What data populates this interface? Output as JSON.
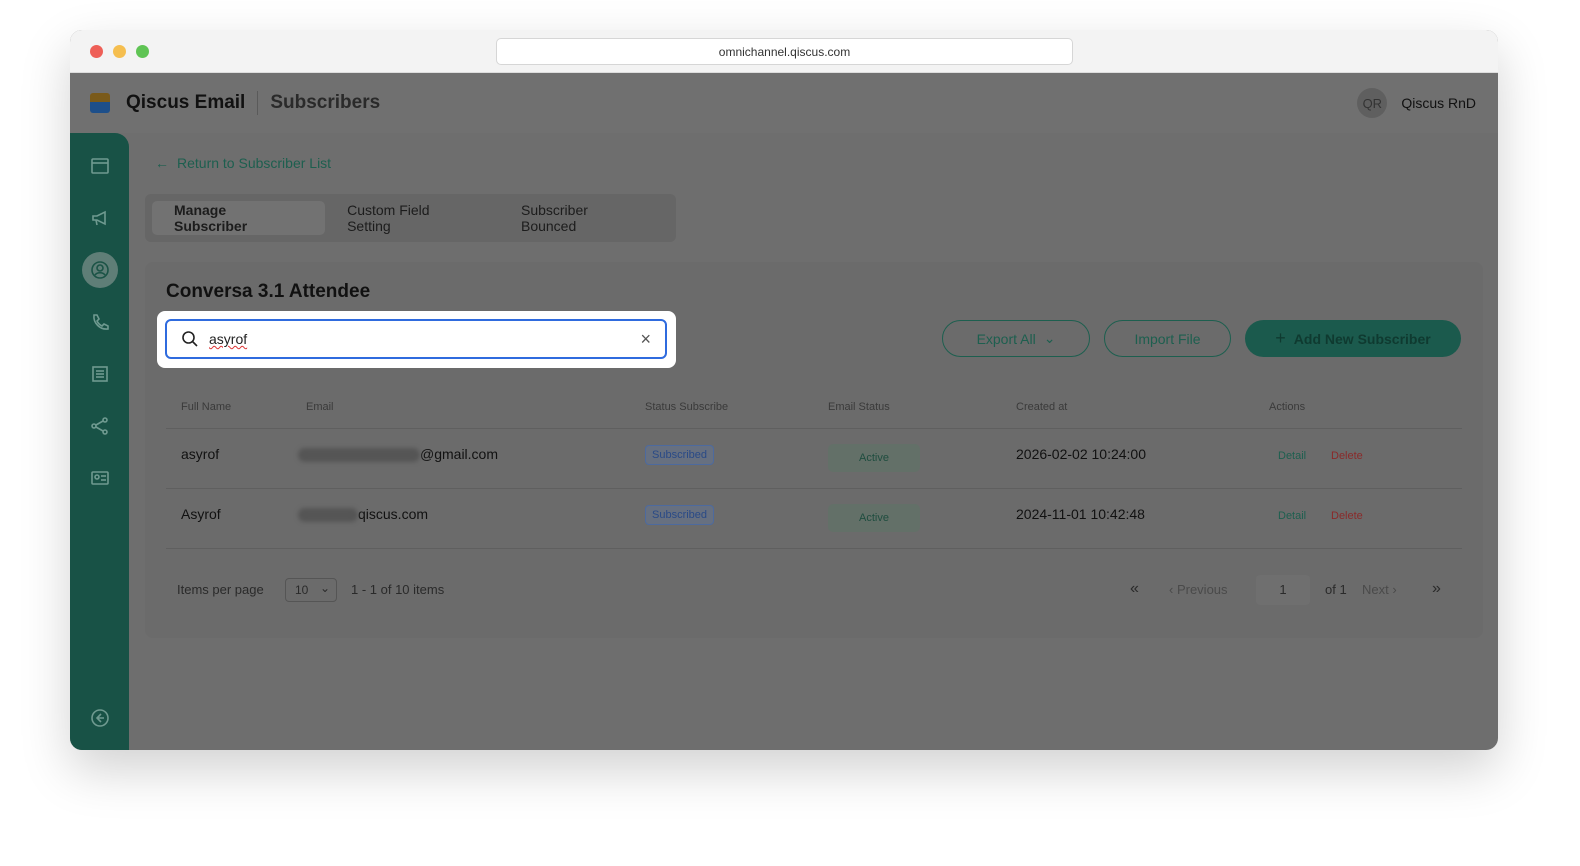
{
  "browser": {
    "url": "omnichannel.qiscus.com"
  },
  "header": {
    "app_name": "Qiscus Email",
    "page_title": "Subscribers",
    "avatar_initials": "QR",
    "user_name": "Qiscus RnD"
  },
  "back_link": "Return to Subscriber List",
  "tabs": [
    "Manage Subscriber",
    "Custom Field Setting",
    "Subscriber Bounced"
  ],
  "list_title": "Conversa 3.1 Attendee",
  "search": {
    "value": "asyrof"
  },
  "buttons": {
    "export": "Export All",
    "import": "Import File",
    "add": "Add New Subscriber"
  },
  "columns": [
    "Full Name",
    "Email",
    "Status Subscribe",
    "Email Status",
    "Created at",
    "Actions"
  ],
  "rows": [
    {
      "name": "asyrof",
      "email_suffix": "@gmail.com",
      "status": "Subscribed",
      "email_status": "Active",
      "created": "2026-02-02 10:24:00",
      "detail": "Detail",
      "delete": "Delete"
    },
    {
      "name": "Asyrof",
      "email_suffix": "qiscus.com",
      "status": "Subscribed",
      "email_status": "Active",
      "created": "2024-11-01 10:42:48",
      "detail": "Detail",
      "delete": "Delete"
    }
  ],
  "pagination": {
    "items_per_page_label": "Items per page",
    "per_page": "10",
    "range": "1 - 1 of 10 items",
    "previous": "Previous",
    "page": "1",
    "of": "of 1",
    "next": "Next"
  }
}
